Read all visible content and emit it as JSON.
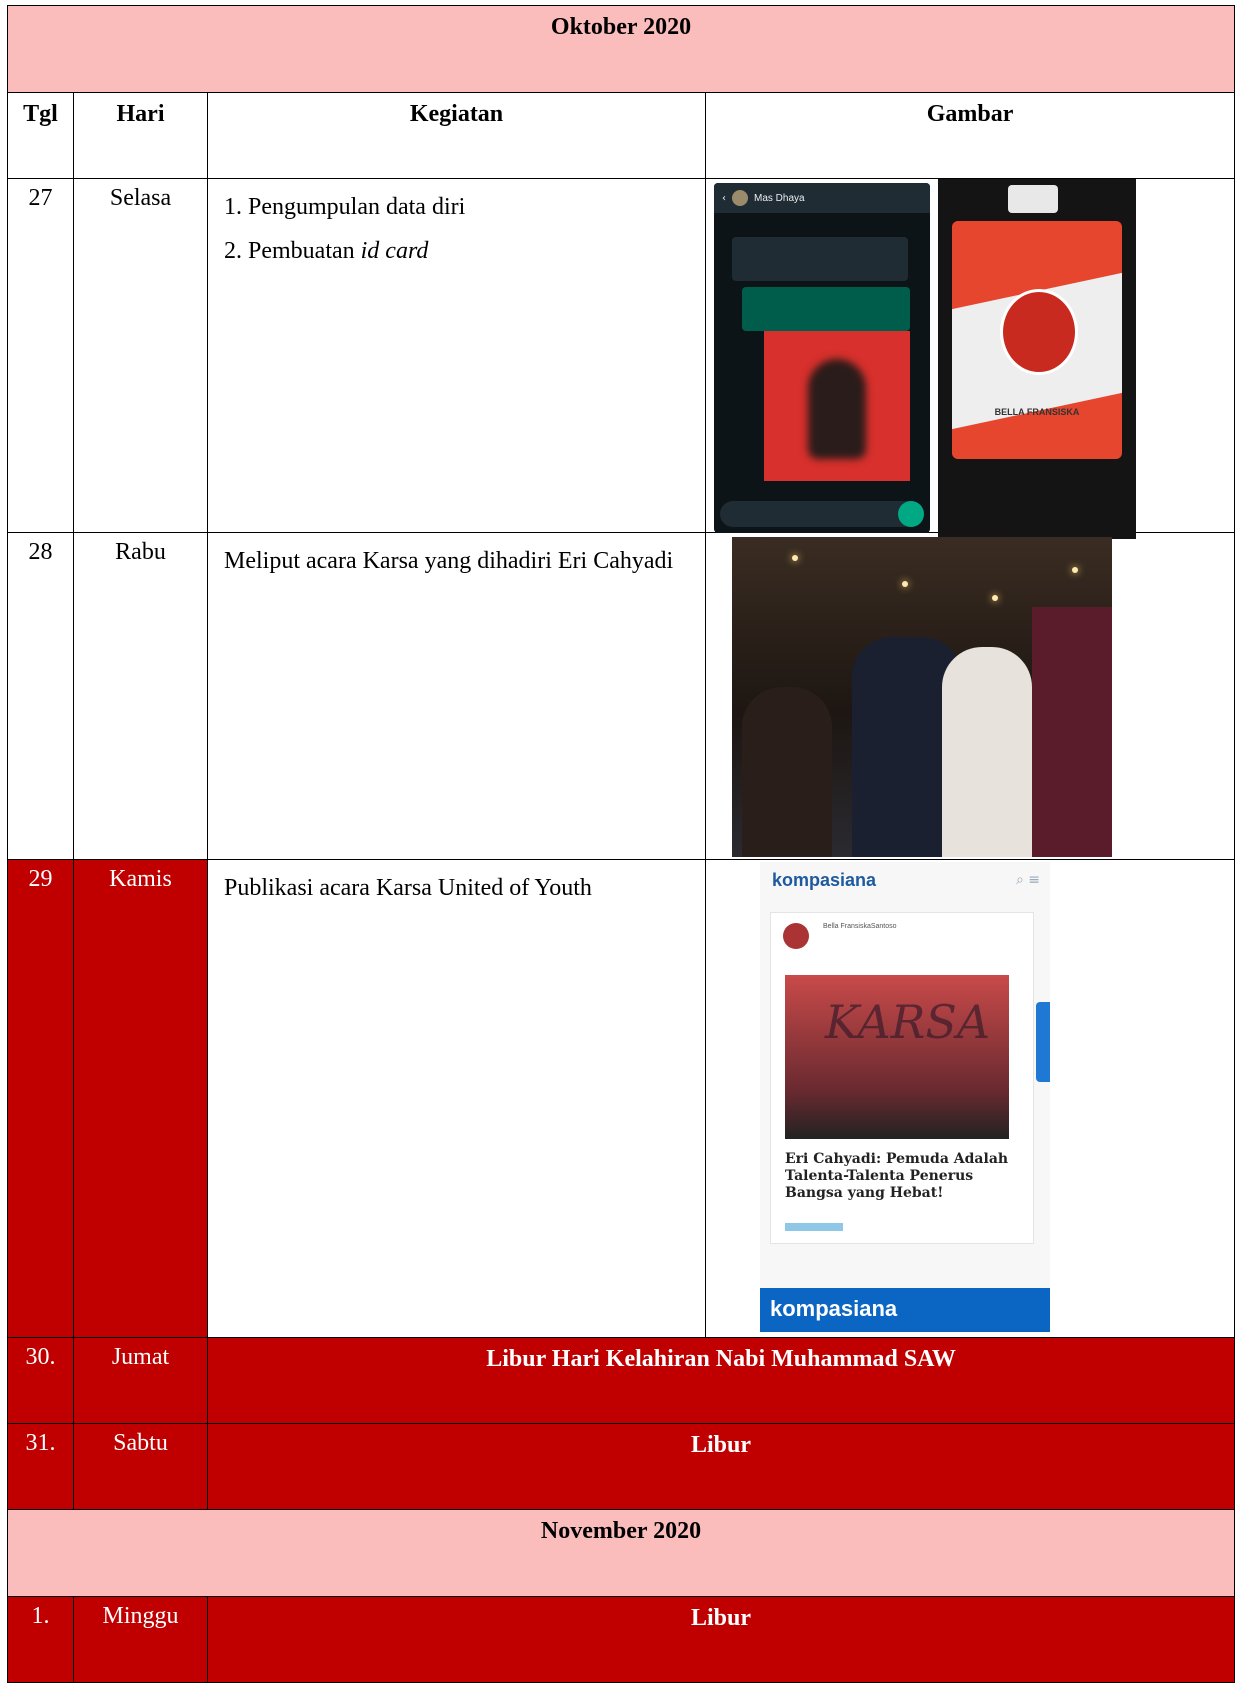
{
  "months": {
    "oktober": "Oktober 2020",
    "november": "November 2020"
  },
  "headers": {
    "tgl": "Tgl",
    "hari": "Hari",
    "kegiatan": "Kegiatan",
    "gambar": "Gambar"
  },
  "rows": [
    {
      "tgl": "27",
      "hari": "Selasa",
      "kegiatan_1": "1. Pengumpulan data diri",
      "kegiatan_2_prefix": "2. Pembuatan ",
      "kegiatan_2_italic": "id card",
      "chat_name": "Mas Dhaya",
      "card_name": "BELLA FRANSISKA"
    },
    {
      "tgl": "28",
      "hari": "Rabu",
      "kegiatan": "Meliput acara Karsa yang dihadiri Eri Cahyadi"
    },
    {
      "tgl": "29",
      "hari": "Kamis",
      "kegiatan": "Publikasi acara Karsa United of Youth",
      "site_logo": "kompasiana",
      "author": "Bella FransiskaSantoso",
      "pic_text": "KARSA",
      "article_title": "Eri Cahyadi: Pemuda Adalah Talenta-Talenta Penerus Bangsa yang Hebat!"
    },
    {
      "tgl": "30.",
      "hari": "Jumat",
      "kegiatan": "Libur Hari Kelahiran Nabi Muhammad SAW"
    },
    {
      "tgl": "31.",
      "hari": "Sabtu",
      "kegiatan": "Libur"
    },
    {
      "tgl": "1.",
      "hari": "Minggu",
      "kegiatan": "Libur"
    }
  ],
  "colors": {
    "month_bg": "#fbbcbc",
    "holiday_red": "#c00000"
  }
}
